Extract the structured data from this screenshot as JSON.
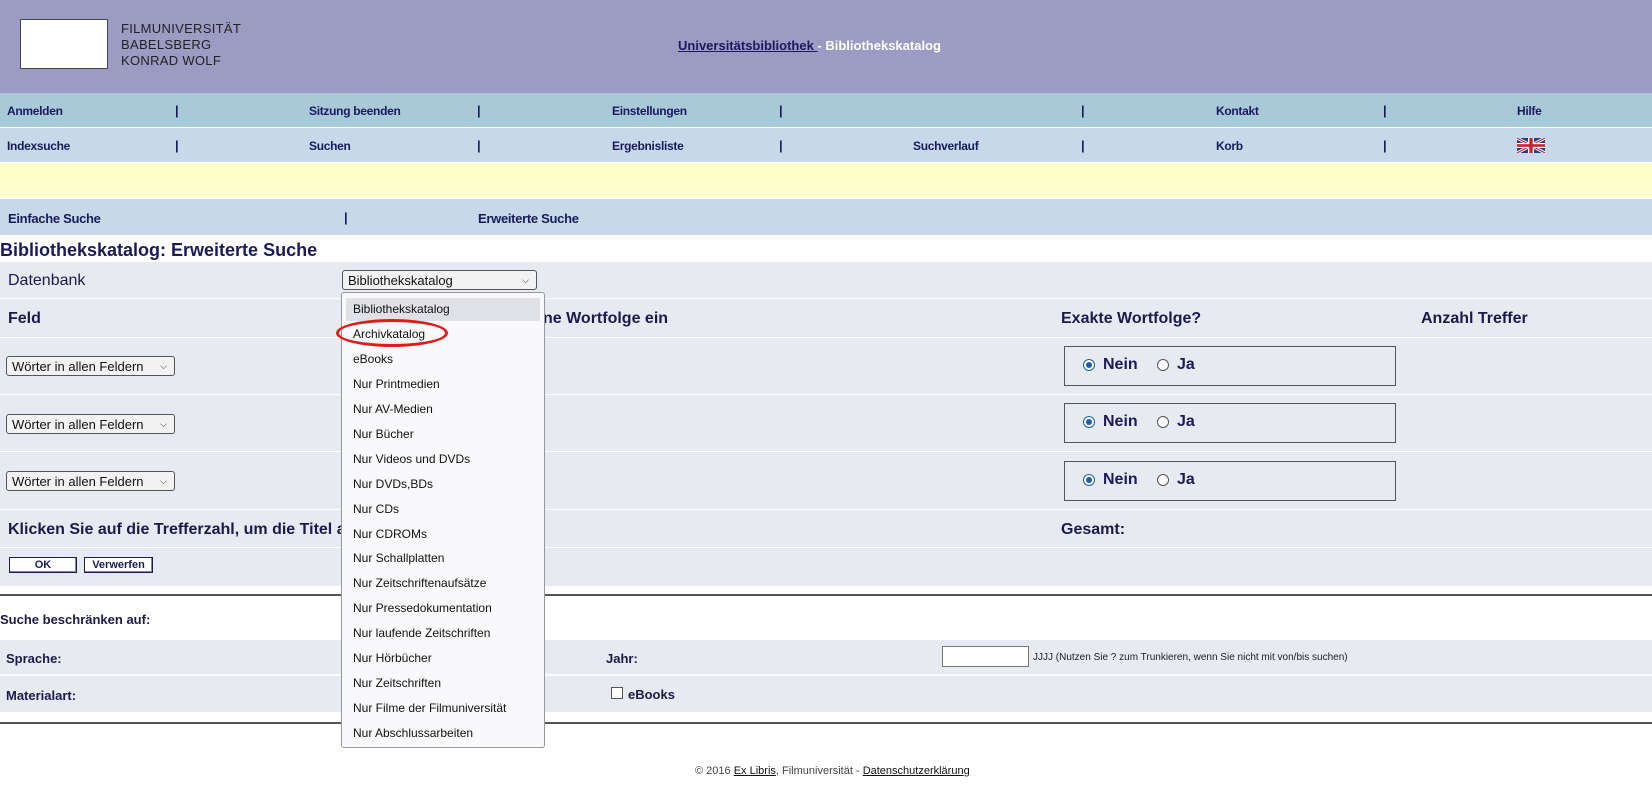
{
  "header": {
    "logo_lines": [
      "FILMUNIVERSITÄT",
      "BABELSBERG",
      "KONRAD WOLF"
    ],
    "title_link": "Universitätsbibliothek ",
    "title_suffix": "- Bibliothekskatalog"
  },
  "nav1": [
    "Anmelden",
    "Sitzung beenden",
    "Einstellungen",
    "",
    "Kontakt",
    "Hilfe"
  ],
  "nav2": [
    "Indexsuche",
    "Suchen",
    "Ergebnisliste",
    "Suchverlauf",
    "Korb"
  ],
  "nav_separator": "|",
  "tabs": {
    "simple": "Einfache Suche",
    "advanced": "Erweiterte Suche"
  },
  "page_title": "Bibliothekskatalog: Erweiterte Suche",
  "form": {
    "database_label": "Datenbank",
    "database_value": "Bibliothekskatalog",
    "field_label": "Feld",
    "input_label_partial": "ne Wortfolge ein",
    "exact_label": "Exakte Wortfolge?",
    "count_label": "Anzahl Treffer",
    "field_select_value": "Wörter in allen Feldern",
    "radio_no": "Nein",
    "radio_yes": "Ja",
    "hint_partial": "Klicken Sie auf die Trefferzahl, um die Titel an",
    "total_label": "Gesamt:",
    "ok_button": "OK",
    "reset_button": "Verwerfen"
  },
  "restrict": {
    "label": "Suche beschränken auf:",
    "language_label": "Sprache:",
    "year_label": "Jahr:",
    "year_value": "",
    "year_hint": "JJJJ (Nutzen Sie ? zum Trunkieren, wenn Sie nicht mit von/bis suchen)",
    "material_label": "Materialart:",
    "ebooks_label": "eBooks"
  },
  "dropdown_options": [
    "Bibliothekskatalog",
    "Archivkatalog",
    "eBooks",
    "Nur Printmedien",
    "Nur AV-Medien",
    "Nur Bücher",
    "Nur Videos und DVDs",
    "Nur DVDs,BDs",
    "Nur CDs",
    "Nur CDROMs",
    "Nur Schallplatten",
    "Nur Zeitschriftenaufsätze",
    "Nur Pressedokumentation",
    "Nur laufende Zeitschriften",
    "Nur Hörbücher",
    "Nur Zeitschriften",
    "Nur Filme der Filmuniversität",
    "Nur Abschlussarbeiten"
  ],
  "highlighted_option": "Archivkatalog",
  "footer": {
    "copyright": "© 2016 ",
    "exlibris": "Ex Libris",
    "middle": ", Filmuniversität - ",
    "privacy": "Datenschutzerklärung"
  },
  "colors": {
    "header_bg": "#9b9bc3",
    "nav1_bg": "#a9c8d8",
    "nav2_bg": "#c7d8e8",
    "notice_bg": "#ffffcc",
    "highlight": "#e01b1b"
  }
}
